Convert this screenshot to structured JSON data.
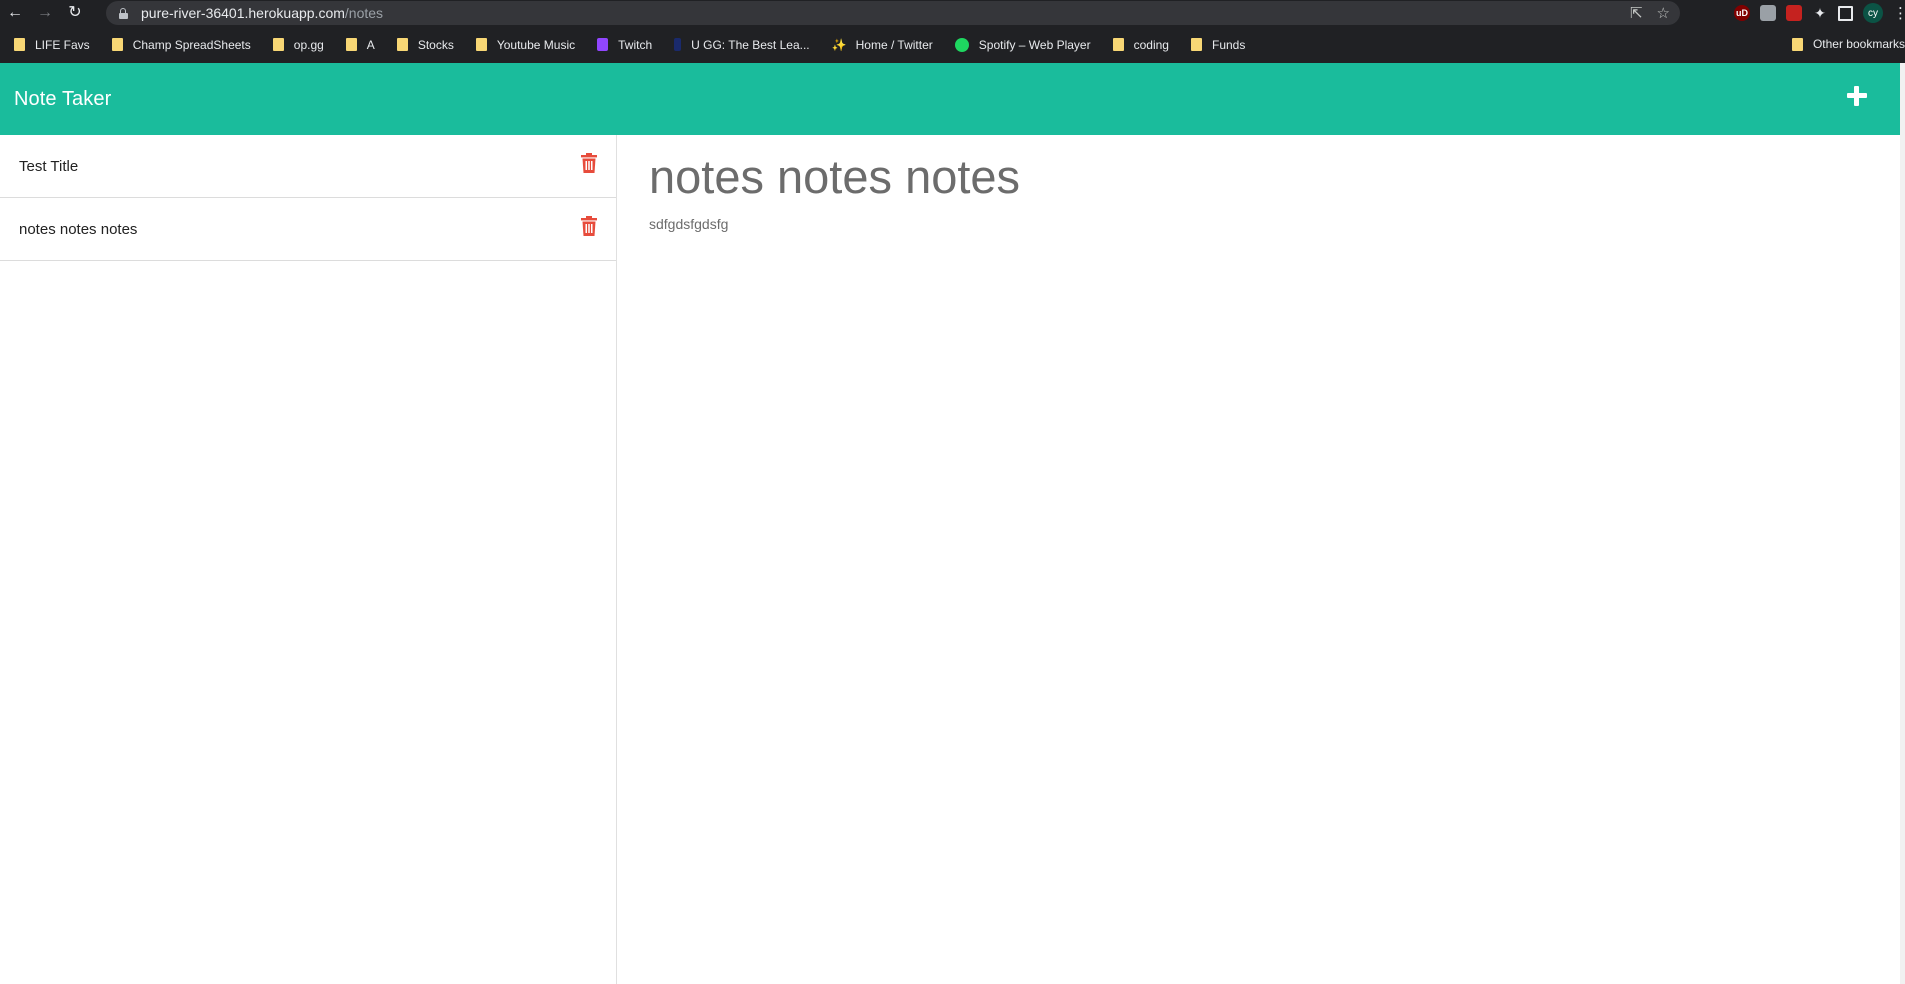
{
  "browser": {
    "url_host": "pure-river-36401.herokuapp.com",
    "url_path": "/notes",
    "profile_initials": "cy",
    "ublock_badge": "uD"
  },
  "bookmarks": [
    {
      "label": "LIFE Favs",
      "icon": "folder-icon"
    },
    {
      "label": "Champ SpreadSheets",
      "icon": "folder-icon"
    },
    {
      "label": "op.gg",
      "icon": "folder-icon"
    },
    {
      "label": "A",
      "icon": "folder-icon"
    },
    {
      "label": "Stocks",
      "icon": "folder-icon"
    },
    {
      "label": "Youtube Music",
      "icon": "folder-icon"
    },
    {
      "label": "Twitch",
      "icon": "twitch-icon"
    },
    {
      "label": "U GG: The Best Lea...",
      "icon": "ugg-icon"
    },
    {
      "label": "Home / Twitter",
      "icon": "twitter-icon"
    },
    {
      "label": "Spotify – Web Player",
      "icon": "spotify-icon"
    },
    {
      "label": "coding",
      "icon": "folder-icon"
    },
    {
      "label": "Funds",
      "icon": "folder-icon"
    }
  ],
  "other_bookmarks": "Other bookmarks",
  "app": {
    "title": "Note Taker",
    "accent_color": "#1abc9c",
    "delete_color": "#e74c3c"
  },
  "notes": [
    {
      "title": "Test Title"
    },
    {
      "title": "notes notes notes"
    }
  ],
  "active_note": {
    "title": "notes notes notes",
    "text": "sdfgdsfgdsfg"
  }
}
